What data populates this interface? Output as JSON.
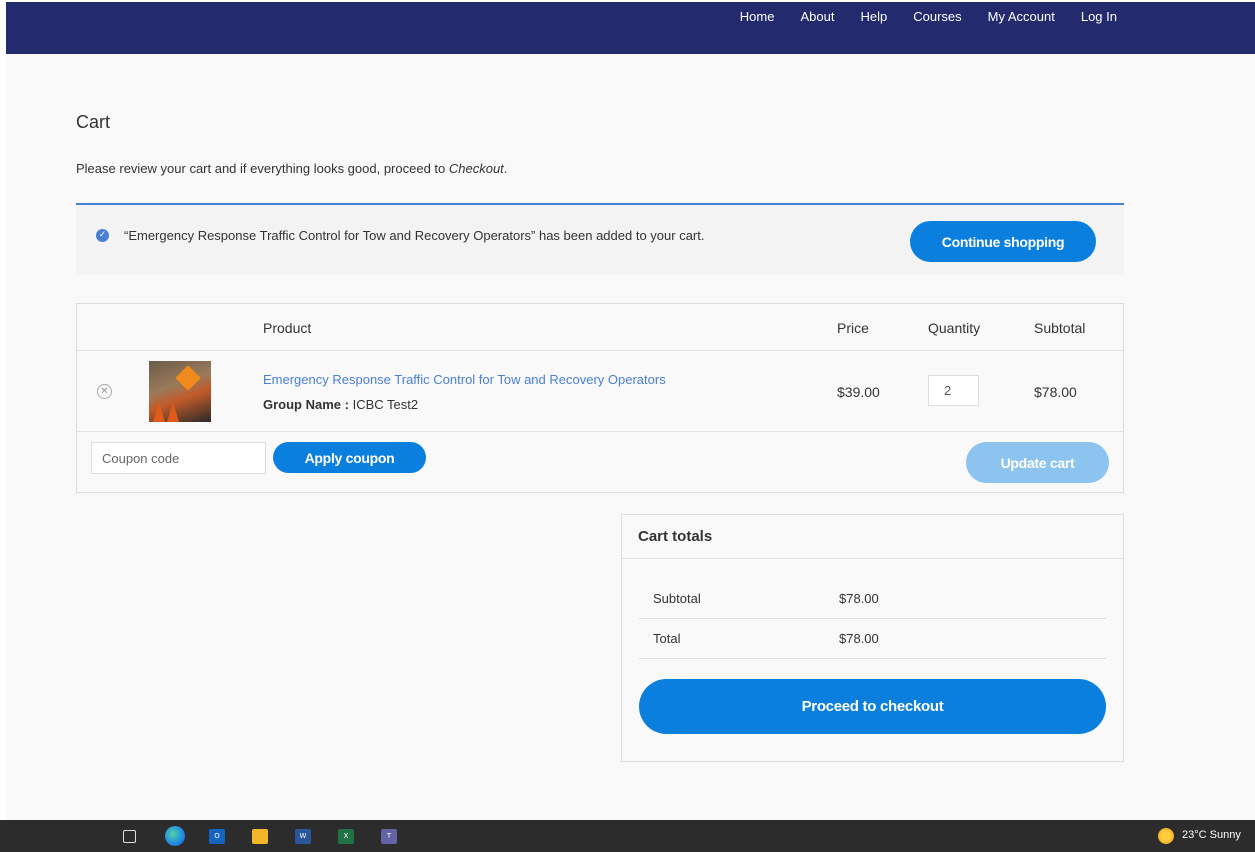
{
  "nav": {
    "items": [
      "Home",
      "About",
      "Help",
      "Courses",
      "My Account",
      "Log In"
    ]
  },
  "page": {
    "title": "Cart",
    "intro_prefix": "Please review your cart and if everything looks good, proceed to ",
    "intro_emphasis": "Checkout",
    "intro_suffix": "."
  },
  "notice": {
    "text": "“Emergency Response Traffic Control for Tow and Recovery Operators” has been added to your cart.",
    "button": "Continue shopping"
  },
  "cart": {
    "headers": {
      "product": "Product",
      "price": "Price",
      "quantity": "Quantity",
      "subtotal": "Subtotal"
    },
    "item": {
      "name": "Emergency Response Traffic Control for Tow and Recovery Operators",
      "meta_label": "Group Name",
      "meta_sep": " : ",
      "meta_value": "ICBC Test2",
      "price": "$39.00",
      "quantity": "2",
      "subtotal": "$78.00"
    },
    "coupon_placeholder": "Coupon code",
    "apply_button": "Apply coupon",
    "update_button": "Update cart"
  },
  "totals": {
    "title": "Cart totals",
    "subtotal_label": "Subtotal",
    "subtotal_value": "$78.00",
    "total_label": "Total",
    "total_value": "$78.00",
    "checkout_button": "Proceed to checkout"
  },
  "taskbar": {
    "weather": "23°C  Sunny"
  },
  "colors": {
    "header": "#232a6e",
    "accent": "#0b7fde",
    "disabled": "#8dc3ef",
    "link": "#4a7fd6"
  }
}
